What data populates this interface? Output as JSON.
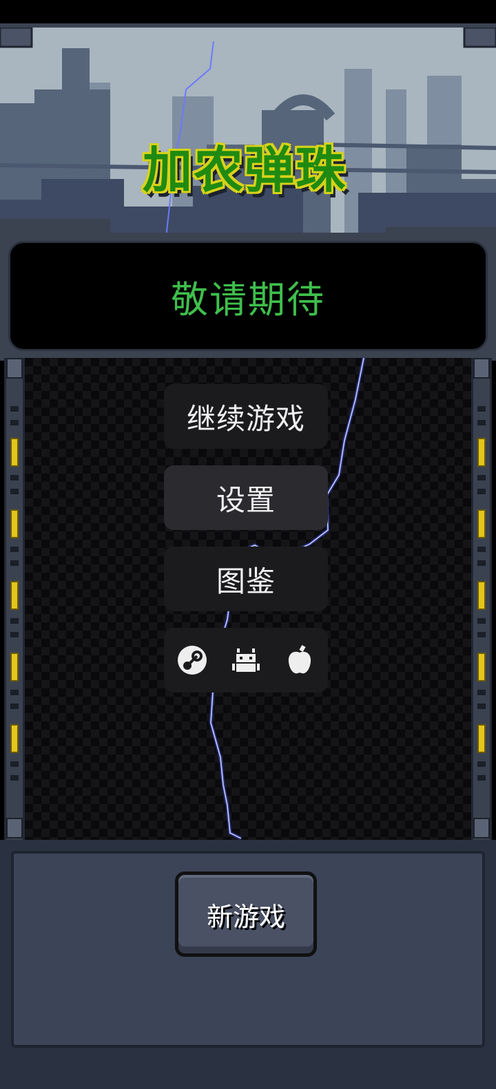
{
  "game": {
    "title": "加农弹珠",
    "banner": "敬请期待"
  },
  "menu": {
    "continue_label": "继续游戏",
    "settings_label": "设置",
    "codex_label": "图鉴",
    "platforms": [
      "steam-icon",
      "android-icon",
      "apple-icon"
    ]
  },
  "footer": {
    "new_game_label": "新游戏"
  },
  "colors": {
    "banner_text": "#3fbf4c",
    "title_fill": "#1f8a12",
    "title_outline": "#d8d21a",
    "warning_stripe": "#e3c51d",
    "lightning": "#5a6bff"
  }
}
